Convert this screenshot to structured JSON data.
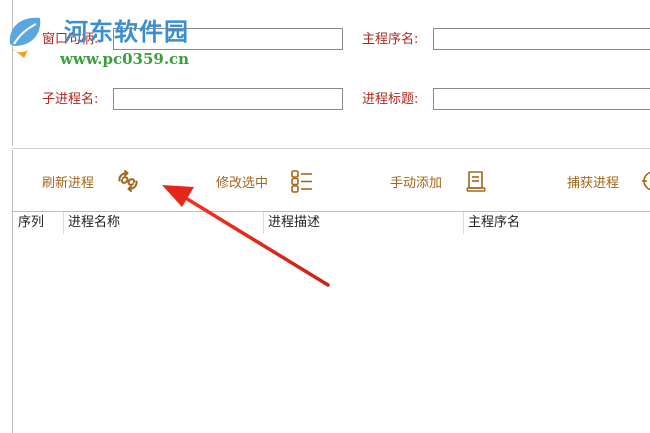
{
  "watermark": {
    "site_name": "河东软件园",
    "url": "www.pc0359.cn"
  },
  "form": {
    "window_handle_label": "窗口句柄:",
    "window_handle_value": "",
    "main_process_label": "主程序名:",
    "main_process_value": "",
    "sub_process_label": "子进程名:",
    "sub_process_value": "",
    "process_title_label": "进程标题:",
    "process_title_value": ""
  },
  "toolbar": {
    "refresh_label": "刷新进程",
    "edit_label": "修改选中",
    "manual_add_label": "手动添加",
    "capture_label": "捕获进程"
  },
  "table": {
    "columns": [
      "序列",
      "进程名称",
      "进程描述",
      "主程序名"
    ],
    "rows": []
  },
  "colors": {
    "label_red": "#b0261d",
    "toolbar_orange": "#a5661b",
    "arrow_red": "#d9241c"
  }
}
